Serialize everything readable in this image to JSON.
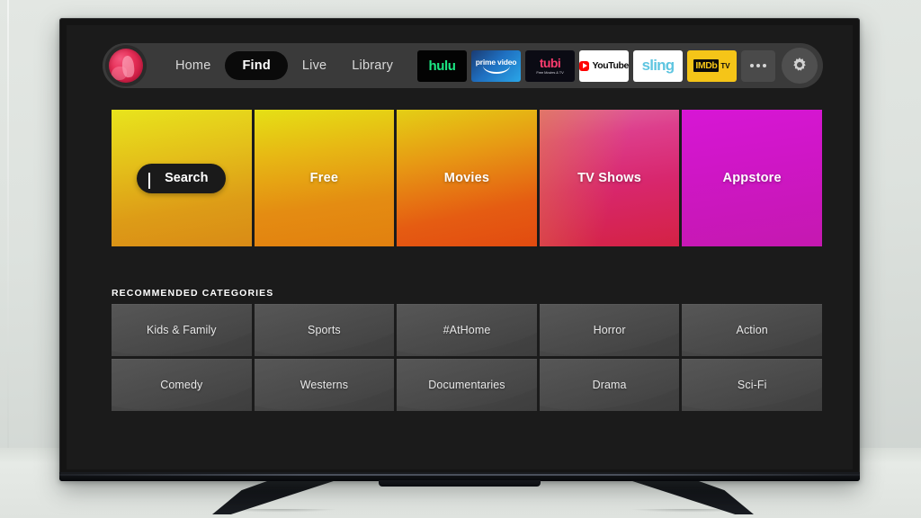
{
  "nav": {
    "avatar_name": "user-avatar",
    "links": [
      {
        "label": "Home",
        "active": false
      },
      {
        "label": "Find",
        "active": true
      },
      {
        "label": "Live",
        "active": false
      },
      {
        "label": "Library",
        "active": false
      }
    ],
    "apps": [
      {
        "name": "hulu",
        "text": "hulu",
        "sub": ""
      },
      {
        "name": "prime-video",
        "text": "prime video",
        "sub": ""
      },
      {
        "name": "tubi",
        "text": "tubi",
        "sub": "Free Movies & TV"
      },
      {
        "name": "youtube",
        "text": "YouTube",
        "sub": ""
      },
      {
        "name": "sling",
        "text": "sling",
        "sub": ""
      },
      {
        "name": "imdb-tv",
        "text": "IMDb",
        "sub": "TV"
      }
    ],
    "more_label": "More",
    "settings_label": "Settings"
  },
  "hero": {
    "tiles": [
      {
        "label": "Search",
        "is_search": true
      },
      {
        "label": "Free",
        "is_search": false
      },
      {
        "label": "Movies",
        "is_search": false
      },
      {
        "label": "TV Shows",
        "is_search": false
      },
      {
        "label": "Appstore",
        "is_search": false
      }
    ]
  },
  "recommended": {
    "title": "RECOMMENDED CATEGORIES",
    "categories": [
      "Kids & Family",
      "Sports",
      "#AtHome",
      "Horror",
      "Action",
      "Comedy",
      "Westerns",
      "Documentaries",
      "Drama",
      "Sci-Fi"
    ]
  },
  "colors": {
    "wall": "#dde2de",
    "screen_bg": "#1b1b1b",
    "nav_bg": "#3a3a3a",
    "active_pill": "#0a0a0a",
    "hulu_green": "#1ce783",
    "tubi_pink": "#ff3c6f",
    "youtube_red": "#ff0000",
    "sling_blue": "#5ec5e0",
    "imdb_yellow": "#f5c518",
    "gradient_start": "#e3e21a",
    "gradient_mid": "#e05a16",
    "gradient_end": "#d619c8"
  }
}
